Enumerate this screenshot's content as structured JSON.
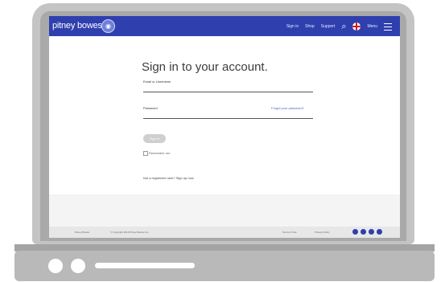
{
  "nav": {
    "brand": "pitney bowes",
    "links": [
      "Sign in",
      "Shop",
      "Support"
    ],
    "menu_label": "Menu"
  },
  "form": {
    "title": "Sign in to your account.",
    "email_label": "Email or Username",
    "password_label": "Password",
    "forgot_link": "Forgot your password?",
    "signin_button": "Sign in",
    "remember_me": "Remember me",
    "new_user_text": "Not a registered user? Sign up now"
  },
  "footer": {
    "left_text": "Pitney Bowes",
    "copyright": "© Copyright 2019 Pitney Bowes Inc.",
    "links": [
      "Terms of Use",
      "Privacy Policy"
    ]
  },
  "colors": {
    "brand_blue": "#2f3fae"
  }
}
